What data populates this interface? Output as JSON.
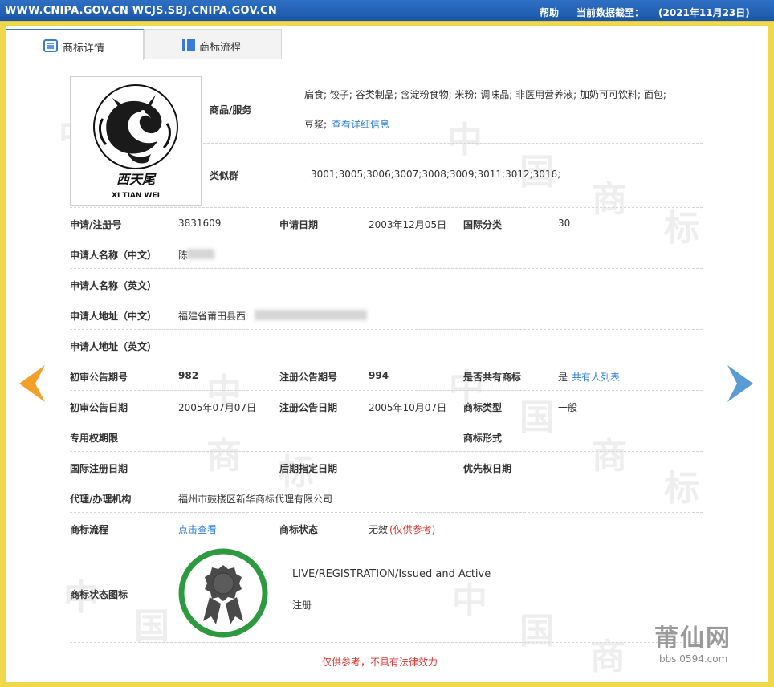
{
  "topbar": {
    "urls": "WWW.CNIPA.GOV.CN WCJS.SBJ.CNIPA.GOV.CN",
    "help": "帮助",
    "date_label": "当前数据截至：",
    "date_value": "(2021年11月23日)"
  },
  "tabs": [
    {
      "label": "商标详情",
      "icon": "document-list-icon",
      "active": true
    },
    {
      "label": "商标流程",
      "icon": "grid-list-icon",
      "active": false
    }
  ],
  "trademark": {
    "logo_caption_cn": "西天尾",
    "logo_caption_en": "XI TIAN WEI"
  },
  "goods": {
    "label": "商品/服务",
    "text_line1": "扁食; 饺子; 谷类制品; 含淀粉食物; 米粉; 调味品; 非医用营养液; 加奶可可饮料; 面包;",
    "text_line2": "豆浆;",
    "link": "查看详细信息"
  },
  "similar_group": {
    "label": "类似群",
    "value": "3001;3005;3006;3007;3008;3009;3011;3012;3016;"
  },
  "fields": {
    "reg_no_label": "申请/注册号",
    "reg_no": "3831609",
    "app_date_label": "申请日期",
    "app_date": "2003年12月05日",
    "intl_class_label": "国际分类",
    "intl_class": "30",
    "applicant_cn_label": "申请人名称（中文）",
    "applicant_cn": "陈",
    "applicant_en_label": "申请人名称（英文）",
    "address_cn_label": "申请人地址（中文）",
    "address_cn": "福建省莆田县西",
    "address_en_label": "申请人地址（英文）",
    "prelim_no_label": "初审公告期号",
    "prelim_no": "982",
    "reg_announce_no_label": "注册公告期号",
    "reg_announce_no": "994",
    "shared_label": "是否共有商标",
    "shared_value": "是",
    "shared_link": "共有人列表",
    "prelim_date_label": "初审公告日期",
    "prelim_date": "2005年07月07日",
    "reg_announce_date_label": "注册公告日期",
    "reg_announce_date": "2005年10月07日",
    "tm_type_label": "商标类型",
    "tm_type": "一般",
    "exclusive_period_label": "专用权期限",
    "tm_form_label": "商标形式",
    "intl_reg_date_label": "国际注册日期",
    "later_designation_label": "后期指定日期",
    "priority_date_label": "优先权日期",
    "agent_label": "代理/办理机构",
    "agent": "福州市鼓楼区新华商标代理有限公司",
    "process_label": "商标流程",
    "process_link": "点击查看",
    "status_label": "商标状态",
    "status_value": "无效",
    "status_note": "(仅供参考)",
    "status_icon_label": "商标状态图标",
    "status_en": "LIVE/REGISTRATION/Issued and Active",
    "status_cn": "注册"
  },
  "footer_note": "仅供参考，不具有法律效力",
  "watermark_text": [
    "中",
    "国",
    "商",
    "标"
  ],
  "corner_logo": {
    "name": "莆仙网",
    "url": "bbs.0594.com"
  },
  "colors": {
    "topbar": "#1f5fb0",
    "link": "#2f7ecf",
    "red": "#d9332f",
    "badge_ring": "#2e9a3f",
    "arrow_left": "#f2a02a",
    "arrow_right": "#5b9bd5",
    "frame": "#f1d84a"
  }
}
